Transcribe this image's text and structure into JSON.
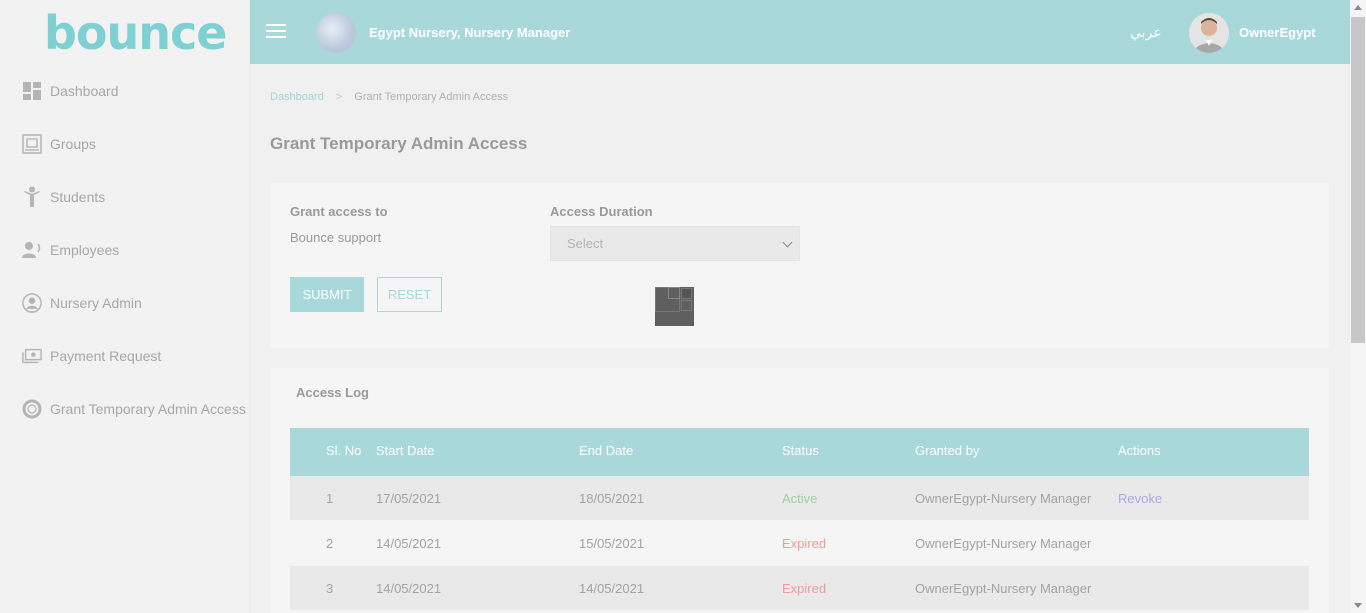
{
  "sidebar": {
    "logo_text": "bounce",
    "items": [
      {
        "label": "Dashboard",
        "icon": "dashboard-icon"
      },
      {
        "label": "Groups",
        "icon": "groups-icon"
      },
      {
        "label": "Students",
        "icon": "students-icon"
      },
      {
        "label": "Employees",
        "icon": "employees-icon"
      },
      {
        "label": "Nursery Admin",
        "icon": "nursery-admin-icon"
      },
      {
        "label": "Payment Request",
        "icon": "payment-request-icon"
      },
      {
        "label": "Grant Temporary Admin Access",
        "icon": "lifebuoy-icon"
      }
    ]
  },
  "header": {
    "org_name": "Egypt Nursery, Nursery Manager",
    "language": "عربي",
    "user_name": "OwnerEgypt"
  },
  "breadcrumb": {
    "home": "Dashboard",
    "current": "Grant Temporary Admin Access"
  },
  "page_title": "Grant Temporary Admin Access",
  "form": {
    "grant_label": "Grant access to",
    "grant_value": "Bounce support",
    "duration_label": "Access Duration",
    "duration_selected": "Select",
    "submit_label": "SUBMIT",
    "reset_label": "RESET"
  },
  "access_log": {
    "title": "Access Log",
    "columns": [
      "Sl. No",
      "Start Date",
      "End Date",
      "Status",
      "Granted by",
      "Actions"
    ],
    "rows": [
      {
        "no": "1",
        "start": "17/05/2021",
        "end": "18/05/2021",
        "status": "Active",
        "granted_by": "OwnerEgypt-Nursery Manager",
        "action": "Revoke"
      },
      {
        "no": "2",
        "start": "14/05/2021",
        "end": "15/05/2021",
        "status": "Expired",
        "granted_by": "OwnerEgypt-Nursery Manager",
        "action": ""
      },
      {
        "no": "3",
        "start": "14/05/2021",
        "end": "14/05/2021",
        "status": "Expired",
        "granted_by": "OwnerEgypt-Nursery Manager",
        "action": ""
      }
    ]
  },
  "colors": {
    "accent": "#a8d8da",
    "logo": "#7ed0d3",
    "active": "#9bd49b",
    "expired": "#ef9a9a",
    "link": "#a9a9e8"
  }
}
